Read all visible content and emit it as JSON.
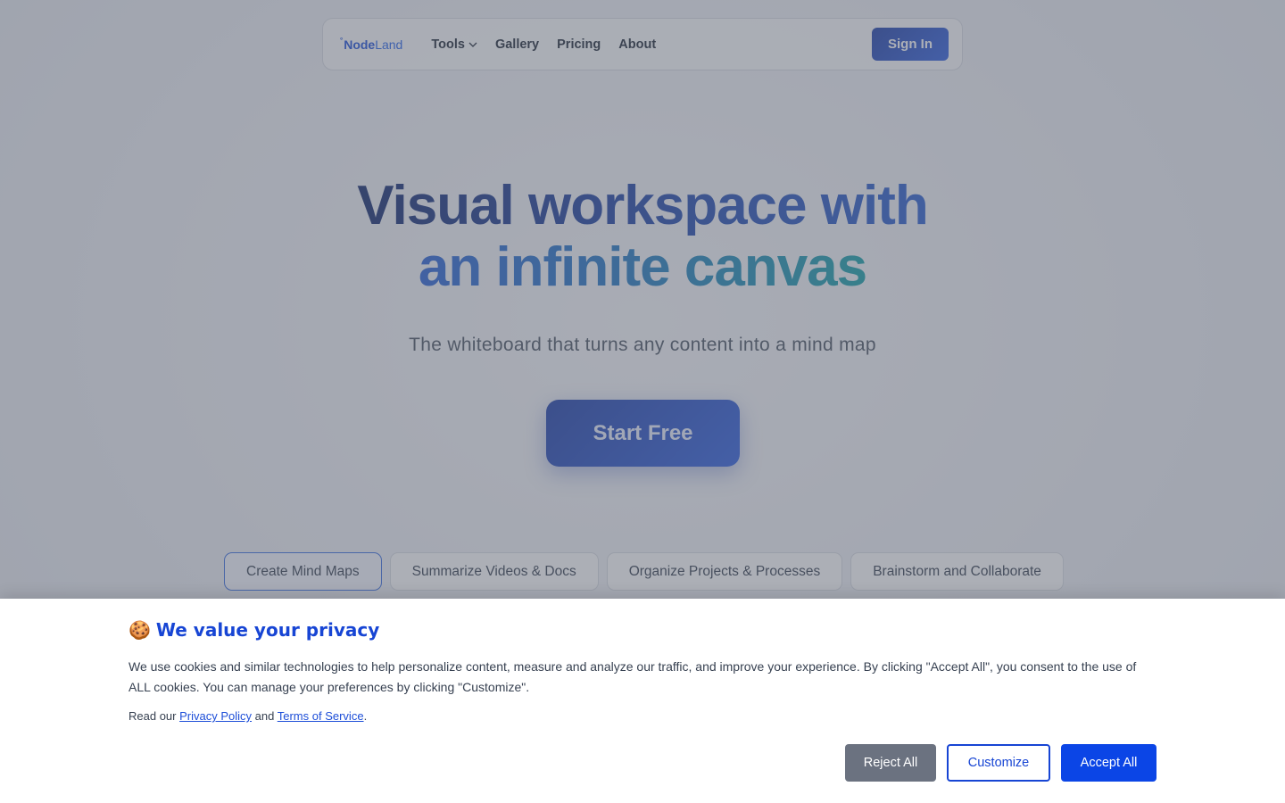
{
  "nav": {
    "logo_dot": "°",
    "logo_bold": "Node",
    "logo_light": "Land",
    "links": [
      {
        "label": "Tools",
        "has_dropdown": true
      },
      {
        "label": "Gallery"
      },
      {
        "label": "Pricing"
      },
      {
        "label": "About"
      }
    ],
    "signin_label": "Sign In"
  },
  "hero": {
    "title_line1": "Visual workspace with",
    "title_line2": "an infinite canvas",
    "subtitle": "The whiteboard that turns any content into a mind map",
    "cta_label": "Start Free"
  },
  "tabs": [
    {
      "label": "Create Mind Maps",
      "active": true
    },
    {
      "label": "Summarize Videos & Docs"
    },
    {
      "label": "Organize Projects & Processes"
    },
    {
      "label": "Brainstorm and Collaborate"
    }
  ],
  "cookie": {
    "emoji": "🍪",
    "title": "We value your privacy",
    "text": "We use cookies and similar technologies to help personalize content, measure and analyze our traffic, and improve your experience. By clicking \"Accept All\", you consent to the use of ALL cookies. You can manage your preferences by clicking \"Customize\".",
    "links_prefix": "Read our",
    "privacy_label": "Privacy Policy",
    "links_and": "and",
    "terms_label": "Terms of Service",
    "links_suffix": ".",
    "reject_label": "Reject All",
    "customize_label": "Customize",
    "accept_label": "Accept All"
  },
  "colors": {
    "brand": "#1d4ed8",
    "accept": "#0b45e6",
    "reject": "#6b7280"
  }
}
